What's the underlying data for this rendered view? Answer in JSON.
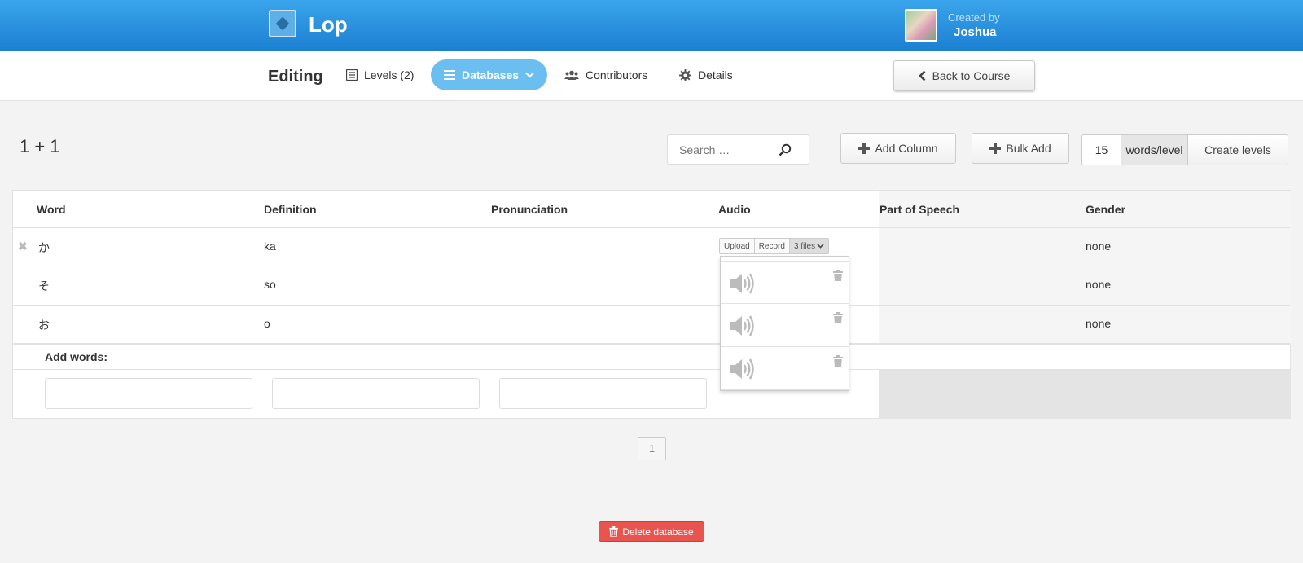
{
  "header": {
    "app_title": "Lop",
    "created_by_label": "Created by",
    "creator_name": "Joshua"
  },
  "nav": {
    "editing_label": "Editing",
    "levels_label": "Levels (2)",
    "databases_label": "Databases",
    "contributors_label": "Contributors",
    "details_label": "Details",
    "back_label": "Back to Course",
    "active_tab": "Databases"
  },
  "toolbar": {
    "database_title": "1 + 1",
    "search_placeholder": "Search …",
    "add_column_label": "Add Column",
    "bulk_add_label": "Bulk Add",
    "words_per_level_value": "15",
    "words_per_level_label": "words/level",
    "create_levels_label": "Create levels"
  },
  "table": {
    "columns": [
      "Word",
      "Definition",
      "Pronunciation",
      "Audio",
      "Part of Speech",
      "Gender"
    ],
    "rows": [
      {
        "word": "か",
        "definition": "ka",
        "pronunciation": "",
        "gender": "none"
      },
      {
        "word": "そ",
        "definition": "so",
        "pronunciation": "",
        "gender": "none"
      },
      {
        "word": "お",
        "definition": "o",
        "pronunciation": "",
        "gender": "none"
      }
    ],
    "add_words_label": "Add words:"
  },
  "audio": {
    "upload_label": "Upload",
    "record_label": "Record",
    "files_label": "3 files",
    "file_count": 3
  },
  "pagination": {
    "current_page": "1"
  },
  "footer": {
    "delete_label": "Delete database"
  },
  "colors": {
    "header_blue": "#1c7fd1",
    "active_tab": "#6bbff0",
    "danger": "#e9544f"
  }
}
